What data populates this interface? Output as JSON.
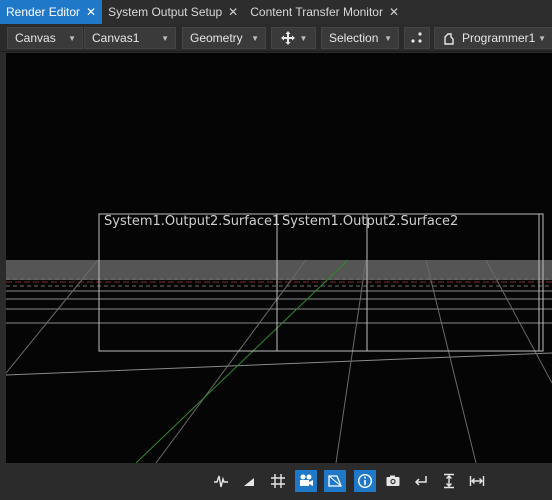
{
  "tabs": [
    {
      "label": "Render Editor",
      "active": true
    },
    {
      "label": "System Output Setup",
      "active": false
    },
    {
      "label": "Content Transfer Monitor",
      "active": false
    }
  ],
  "toolbar": {
    "canvas_type": "Canvas",
    "canvas_name": "Canvas1",
    "mode": "Geometry",
    "tool": "Selection",
    "user": "Programmer1"
  },
  "viewport": {
    "surfaces": [
      {
        "label": "System1.Output2.Surface1"
      },
      {
        "label": "System1.Output2.Surface2"
      }
    ]
  },
  "bottom_toolbar": {
    "buttons": [
      {
        "icon": "waveform-icon",
        "active": false
      },
      {
        "icon": "ramp-icon",
        "active": false
      },
      {
        "icon": "grid-icon",
        "active": false
      },
      {
        "icon": "camera-view-icon",
        "active": true
      },
      {
        "icon": "perspective-icon",
        "active": true
      },
      {
        "icon": "info-icon",
        "active": true
      },
      {
        "icon": "screenshot-icon",
        "active": false
      },
      {
        "icon": "undo-icon",
        "active": false
      },
      {
        "icon": "fit-vertical-icon",
        "active": false
      },
      {
        "icon": "fit-horizontal-icon",
        "active": false
      }
    ]
  },
  "colors": {
    "accent": "#1f79c8",
    "viewport_bg": "#050505",
    "grid_line": "#8a8a8a",
    "green_axis": "#2e8b2e",
    "red_axis": "#7a2b2b"
  }
}
